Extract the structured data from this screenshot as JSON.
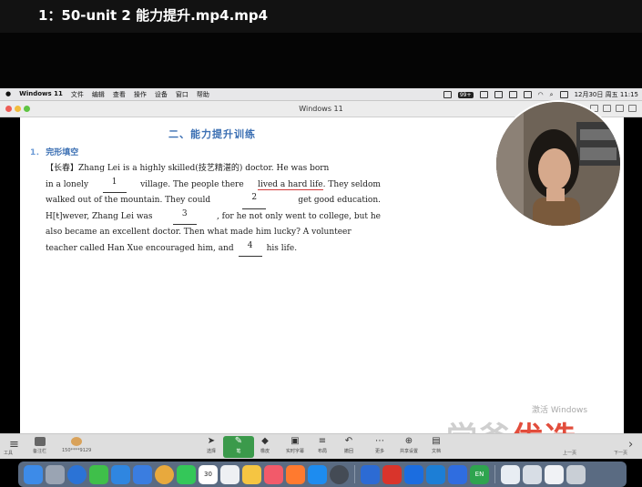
{
  "player": {
    "title": "1：50-unit 2 能力提升.mp4.mp4"
  },
  "menubar": {
    "app_name": "Windows 11",
    "menus": [
      "文件",
      "编辑",
      "查看",
      "操作",
      "设备",
      "窗口",
      "帮助"
    ],
    "badge": "99+",
    "datetime": "12月30日 周五  11:15"
  },
  "vm_window": {
    "title": "Windows 11"
  },
  "document": {
    "section_title": "二、能力提升训练",
    "question_number": "1．",
    "question_title": "完形填空",
    "line1": {
      "pre": "【长春】Zhang Lei is a highly skilled(技艺精湛的) doctor. He was born"
    },
    "line2": {
      "pre": "in a lonely",
      "blank": "1",
      "mid": "village. The people there",
      "mark": "lived a hard life",
      "post": ". They seldom"
    },
    "line3": {
      "pre": "walked out of the mountain. They could",
      "blank": "2",
      "post": "get good education."
    },
    "line4": {
      "pre": "H[ŧ]wever, Zhang Lei was",
      "blank": "3",
      "post": ", for he not only went to college, but he"
    },
    "line5": {
      "text": "also became an excellent doctor. Then what made him lucky? A volunteer"
    },
    "line6": {
      "pre": "teacher called Han Xue encouraged him, and",
      "blank": "4",
      "post": "his life."
    }
  },
  "overlay": {
    "watermark": "激活 Windows",
    "brand_a": "学爸",
    "brand_b": "优选"
  },
  "meeting_toolbar": {
    "left_items": [
      {
        "label": "工具"
      },
      {
        "label": "备注栏"
      },
      {
        "label": "150****9129"
      }
    ],
    "tools": [
      {
        "icon": "pointer-icon",
        "glyph": "➤",
        "label": "选择"
      },
      {
        "icon": "pen-icon",
        "glyph": "✎",
        "label": "笔",
        "active": true
      },
      {
        "icon": "eraser-icon",
        "glyph": "◆",
        "label": "橡皮"
      },
      {
        "icon": "subtitle-icon",
        "glyph": "▣",
        "label": "实时字幕"
      },
      {
        "icon": "layout-icon",
        "glyph": "≡",
        "label": "布局"
      },
      {
        "icon": "undo-icon",
        "glyph": "↶",
        "label": "撤回"
      },
      {
        "icon": "more-icon",
        "glyph": "⋯",
        "label": "更多"
      },
      {
        "icon": "share-icon",
        "glyph": "⊕",
        "label": "共享设置"
      },
      {
        "icon": "doc-icon",
        "glyph": "▤",
        "label": "文档"
      }
    ],
    "right_items": [
      {
        "label": "上一页"
      },
      {
        "label": "下一页"
      }
    ]
  },
  "dock": {
    "calendar_day": "30",
    "mail_badge": "3",
    "lang": "EN",
    "colors": [
      "#3d8be8",
      "#9aa4b3",
      "#2b73d6",
      "#3fbf4a",
      "#2f86e0",
      "#3a7de0",
      "#e8a93d",
      "#34c759",
      "#ffffff",
      "#eef0f3",
      "#f5c542",
      "#f25a6a",
      "#ff7a2f",
      "#1d8cf0",
      "#444b55",
      "#2c6bd4",
      "#d9342b",
      "#1b6de0",
      "#1c7ed6",
      "#2f6de0",
      "#2ea44f"
    ]
  }
}
